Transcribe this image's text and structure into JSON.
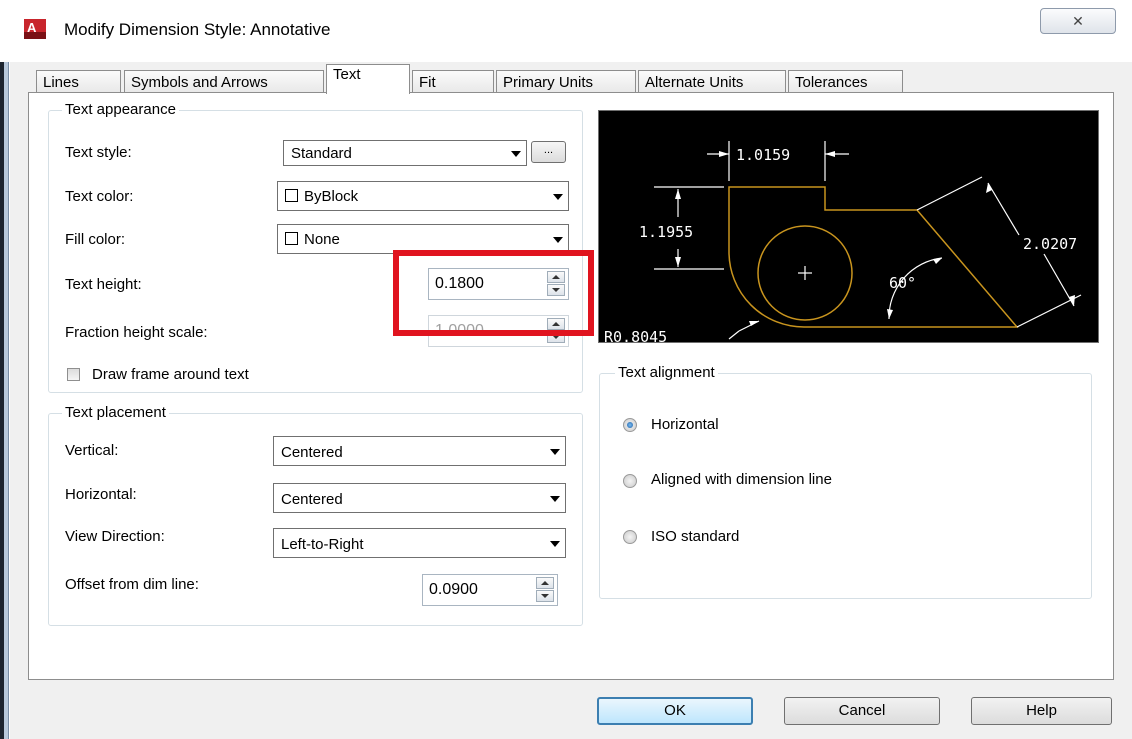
{
  "window": {
    "title": "Modify Dimension Style: Annotative",
    "close_glyph": "✕"
  },
  "tabs": [
    {
      "label": "Lines"
    },
    {
      "label": "Symbols and Arrows"
    },
    {
      "label": "Text",
      "active": true
    },
    {
      "label": "Fit"
    },
    {
      "label": "Primary Units"
    },
    {
      "label": "Alternate Units"
    },
    {
      "label": "Tolerances"
    }
  ],
  "text_appearance": {
    "legend": "Text appearance",
    "text_style_label": "Text style:",
    "text_style_value": "Standard",
    "text_style_browse": "...",
    "text_color_label": "Text color:",
    "text_color_value": "ByBlock",
    "fill_color_label": "Fill color:",
    "fill_color_value": "None",
    "text_height_label": "Text height:",
    "text_height_value": "0.1800",
    "fraction_label": "Fraction height scale:",
    "fraction_value": "1.0000",
    "frame_label": "Draw frame around text",
    "frame_checked": false
  },
  "text_placement": {
    "legend": "Text placement",
    "vertical_label": "Vertical:",
    "vertical_value": "Centered",
    "horizontal_label": "Horizontal:",
    "horizontal_value": "Centered",
    "view_label": "View Direction:",
    "view_value": "Left-to-Right",
    "offset_label": "Offset from dim line:",
    "offset_value": "0.0900"
  },
  "preview": {
    "dim_top": "1.0159",
    "dim_left": "1.1955",
    "dim_right": "2.0207",
    "angle": "60°",
    "radius": "R0.8045",
    "background": "#000000",
    "geometry_color": "#c8941e"
  },
  "text_alignment": {
    "legend": "Text alignment",
    "options": [
      {
        "label": "Horizontal",
        "checked": true
      },
      {
        "label": "Aligned with dimension line",
        "checked": false
      },
      {
        "label": "ISO standard",
        "checked": false
      }
    ]
  },
  "buttons": {
    "ok": "OK",
    "cancel": "Cancel",
    "help": "Help"
  },
  "colors": {
    "highlight_box": "#e0141f",
    "default_button_border": "#3c7fb1"
  }
}
